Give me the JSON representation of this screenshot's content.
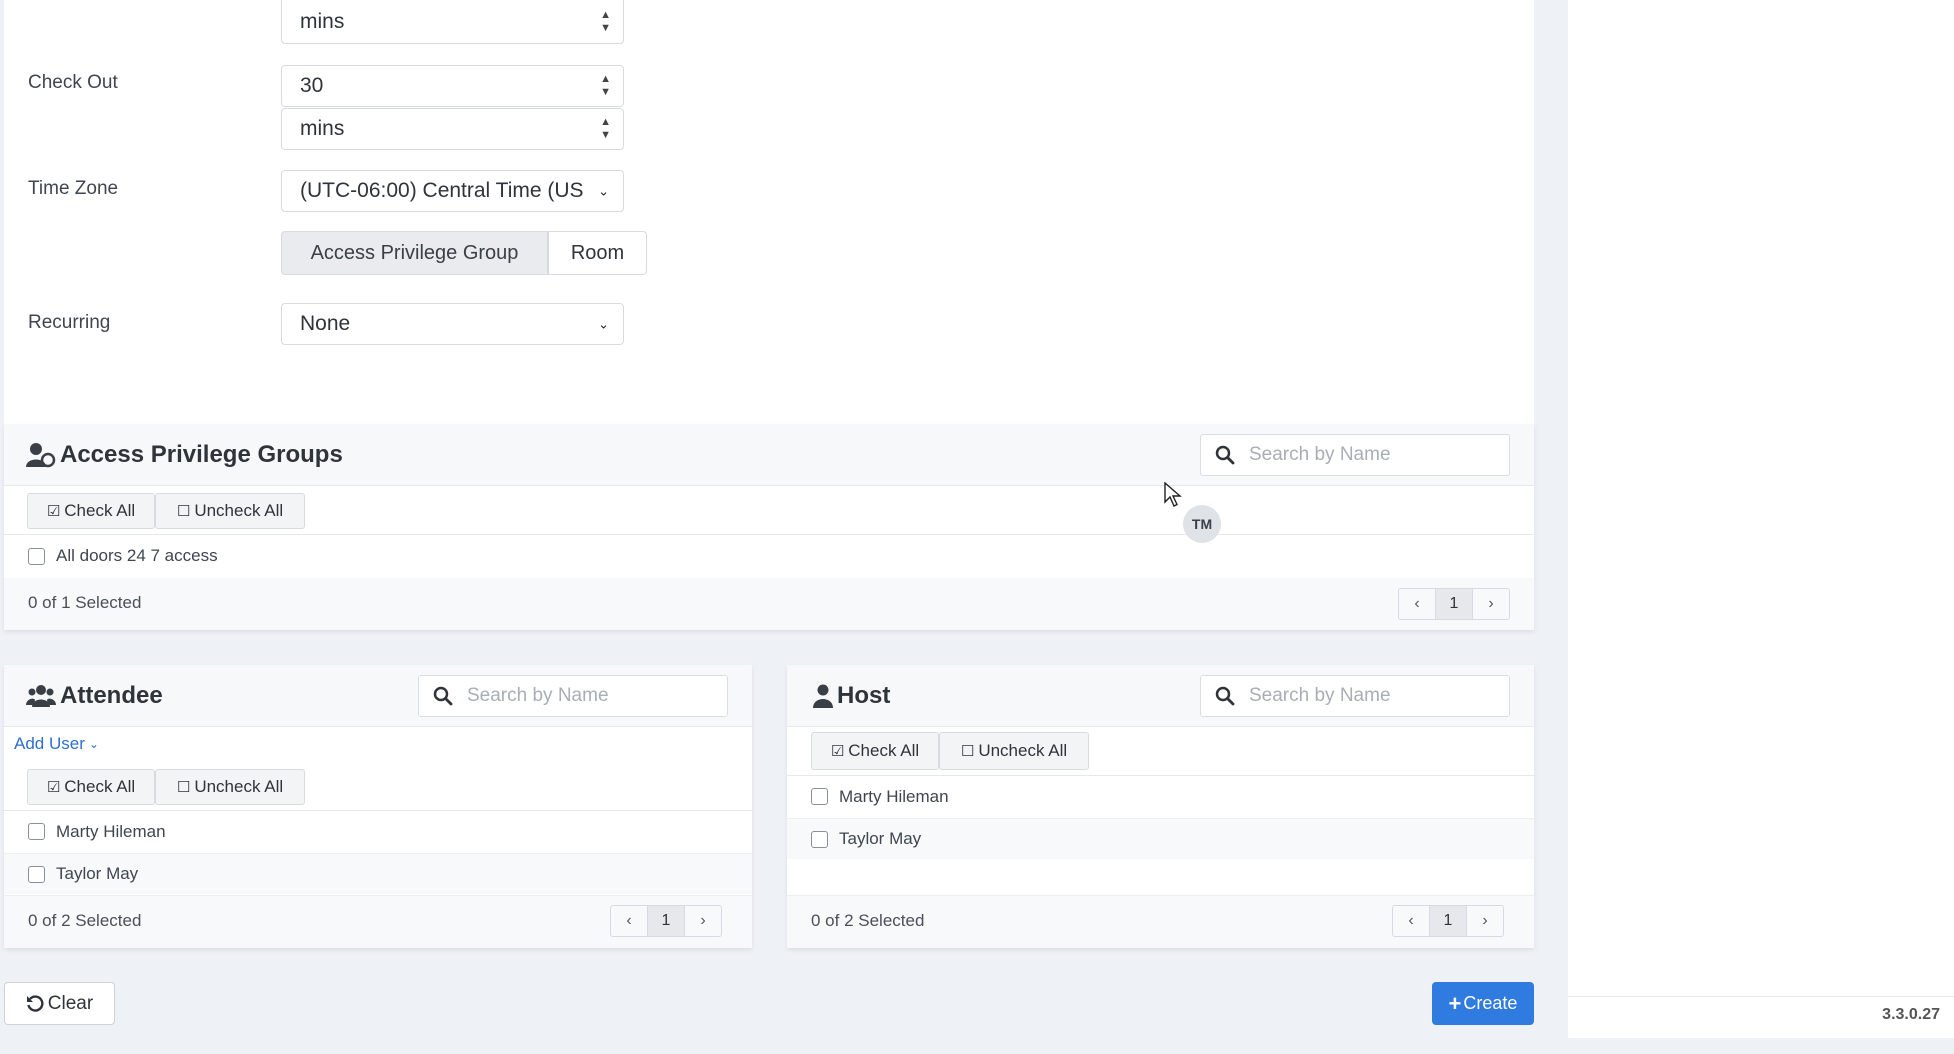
{
  "form": {
    "top_unit": "mins",
    "check_out_label": "Check Out",
    "check_out_value": "30",
    "check_out_unit": "mins",
    "time_zone_label": "Time Zone",
    "time_zone_value": "(UTC-06:00) Central Time (US",
    "target_toggle": {
      "options": [
        "Access Privilege Group",
        "Room"
      ],
      "selected": "Access Privilege Group"
    },
    "recurring_label": "Recurring",
    "recurring_value": "None"
  },
  "access_groups": {
    "title": "Access Privilege Groups",
    "search_placeholder": "Search by Name",
    "check_all": "Check All",
    "uncheck_all": "Uncheck All",
    "items": [
      "All doors 24 7 access"
    ],
    "status": "0 of 1 Selected",
    "page": "1"
  },
  "attendee": {
    "title": "Attendee",
    "search_placeholder": "Search by Name",
    "add_user": "Add User",
    "check_all": "Check All",
    "uncheck_all": "Uncheck All",
    "items": [
      "Marty Hileman",
      "Taylor May"
    ],
    "status": "0 of 2 Selected",
    "page": "1"
  },
  "host": {
    "title": "Host",
    "search_placeholder": "Search by Name",
    "check_all": "Check All",
    "uncheck_all": "Uncheck All",
    "items": [
      "Marty Hileman",
      "Taylor May"
    ],
    "status": "0 of 2 Selected",
    "page": "1"
  },
  "actions": {
    "clear": "Clear",
    "create": "Create"
  },
  "cursor_avatar": "TM",
  "version": "3.3.0.27",
  "colors": {
    "primary": "#2f7be0",
    "background": "#eef1f6"
  }
}
